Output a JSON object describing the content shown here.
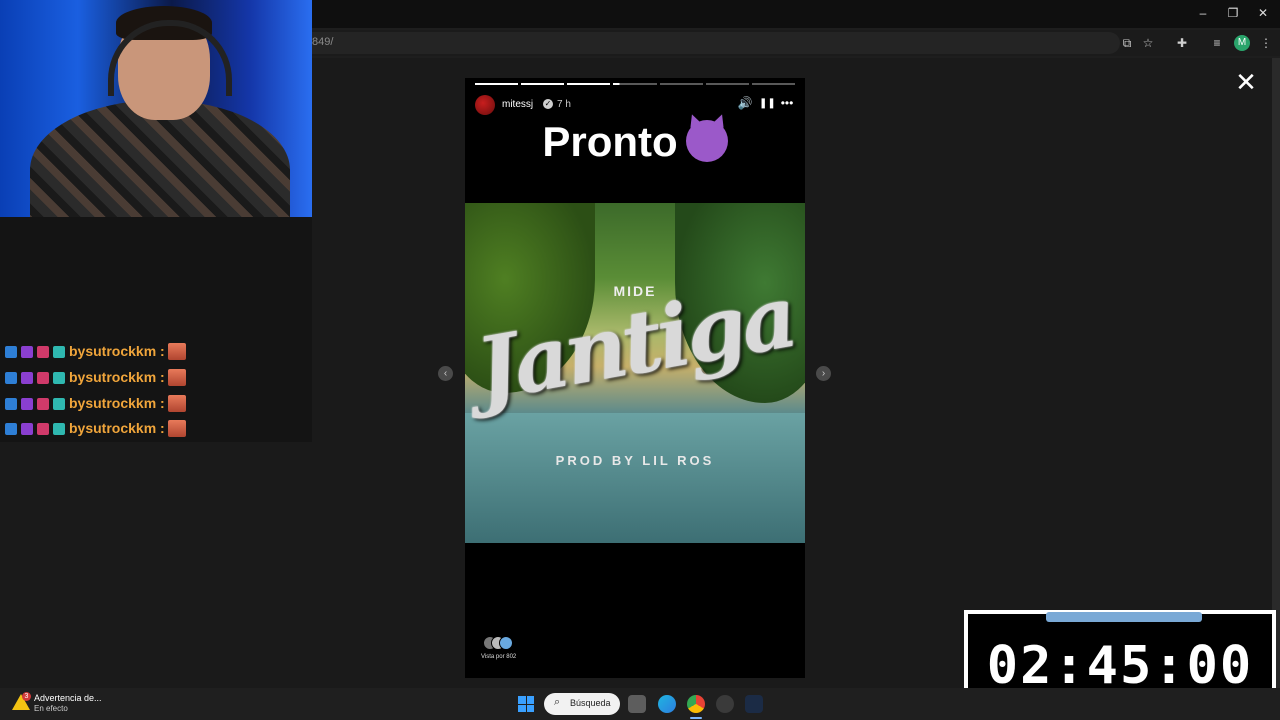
{
  "browser": {
    "url": "849/",
    "window_controls": {
      "minimize": "–",
      "maximize": "❐",
      "close": "✕"
    },
    "profile_initial": "M"
  },
  "story": {
    "username": "mitessj",
    "verified_mark": "✓",
    "time": "7 h",
    "caption": "Pronto",
    "media": {
      "small_text": "MIDE",
      "title": "Jantiga",
      "prod_text": "PROD BY LIL ROS"
    },
    "viewed_by": "Vista por 802",
    "progress": {
      "segments": 7,
      "current_segment": 4
    },
    "close_label": "✕",
    "prev_arrow": "‹",
    "next_arrow": "›",
    "controls": {
      "mute": "🔊",
      "pause": "❚❚",
      "more": "•••"
    }
  },
  "chat": {
    "messages": [
      {
        "user": "bysutrockkm :"
      },
      {
        "user": "bysutrockkm :"
      },
      {
        "user": "bysutrockkm :"
      },
      {
        "user": "bysutrockkm :"
      }
    ]
  },
  "timer": {
    "value": "02:45:00"
  },
  "taskbar": {
    "notification_title": "Advertencia de...",
    "notification_subtitle": "En efecto",
    "notification_count": "3",
    "search_label": "Búsqueda"
  },
  "colors": {
    "chat_username": "#f0a53b",
    "timer_accent": "#7aa9d6",
    "chrome_bg": "#0f0f0f"
  }
}
